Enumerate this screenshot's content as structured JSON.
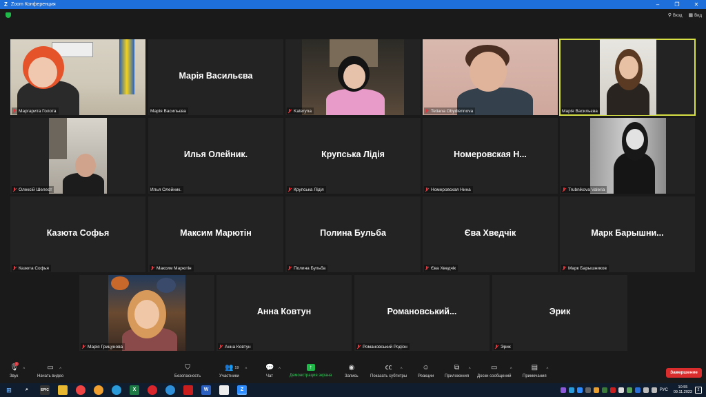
{
  "window": {
    "title": "Zoom Конференция",
    "minimize": "–",
    "restore": "❐",
    "close": "✕"
  },
  "topbar": {
    "signin_label": "Вход",
    "view_label": "Вид"
  },
  "tiles": [
    {
      "id": "t1",
      "name": "Маргарита Голота",
      "big": "",
      "video": true
    },
    {
      "id": "t2",
      "name": "Марія Васильєва",
      "big": "Марія Васильєва",
      "video": false
    },
    {
      "id": "t3",
      "name": "Kateryna",
      "big": "",
      "video": true
    },
    {
      "id": "t4",
      "name": "Tetiana Obydiennova",
      "big": "",
      "video": true
    },
    {
      "id": "t5",
      "name": "Марія Васильєва",
      "big": "",
      "video": true,
      "active": true
    },
    {
      "id": "t6",
      "name": "Олексій Шелест",
      "big": "",
      "video": true
    },
    {
      "id": "t7",
      "name": "Илья Олейник.",
      "big": "Илья Олейник.",
      "video": false
    },
    {
      "id": "t8",
      "name": "Крупська Лідія",
      "big": "Крупська Лідія",
      "video": false
    },
    {
      "id": "t9",
      "name": "Номеровская Нина",
      "big": "Номеровская  Н...",
      "video": false
    },
    {
      "id": "t10",
      "name": "Trubnikova Valeria",
      "big": "",
      "video": true
    },
    {
      "id": "t11",
      "name": "Казюта Софья",
      "big": "Казюта Софья",
      "video": false
    },
    {
      "id": "t12",
      "name": "Максим Марютін",
      "big": "Максим Марютін",
      "video": false
    },
    {
      "id": "t13",
      "name": "Полина Бульба",
      "big": "Полина Бульба",
      "video": false
    },
    {
      "id": "t14",
      "name": "Єва Хведчік",
      "big": "Єва Хведчік",
      "video": false
    },
    {
      "id": "t15",
      "name": "Марк Барышников",
      "big": "Марк  Барышни...",
      "video": false
    },
    {
      "id": "t16",
      "name": "Марія Грицунова",
      "big": "",
      "video": true
    },
    {
      "id": "t17",
      "name": "Анна Ковтун",
      "big": "Анна Ковтун",
      "video": false
    },
    {
      "id": "t18",
      "name": "Романовський Родіон",
      "big": "Романовський...",
      "video": false
    },
    {
      "id": "t19",
      "name": "Эрик",
      "big": "Эрик",
      "video": false
    }
  ],
  "toolbar": {
    "audio": "Звук",
    "video": "Начать видео",
    "security": "Безопасность",
    "participants": "Участники",
    "participants_count": "19",
    "chat": "Чат",
    "share": "Демонстрация экрана",
    "record": "Запись",
    "captions": "Показать субтитры",
    "reactions": "Реакции",
    "apps": "Приложения",
    "whiteboards": "Доски сообщений",
    "notes": "Примечания",
    "end": "Завершение",
    "audio_badge": "!"
  },
  "taskbar": {
    "lang": "РУС",
    "time": "10:55",
    "date": "09.11.2023",
    "notif_count": "2"
  },
  "colors": {
    "accent": "#1e6fd9",
    "end_red": "#d92d2d",
    "share_green": "#1fb849",
    "active_speaker": "#d7e045"
  }
}
